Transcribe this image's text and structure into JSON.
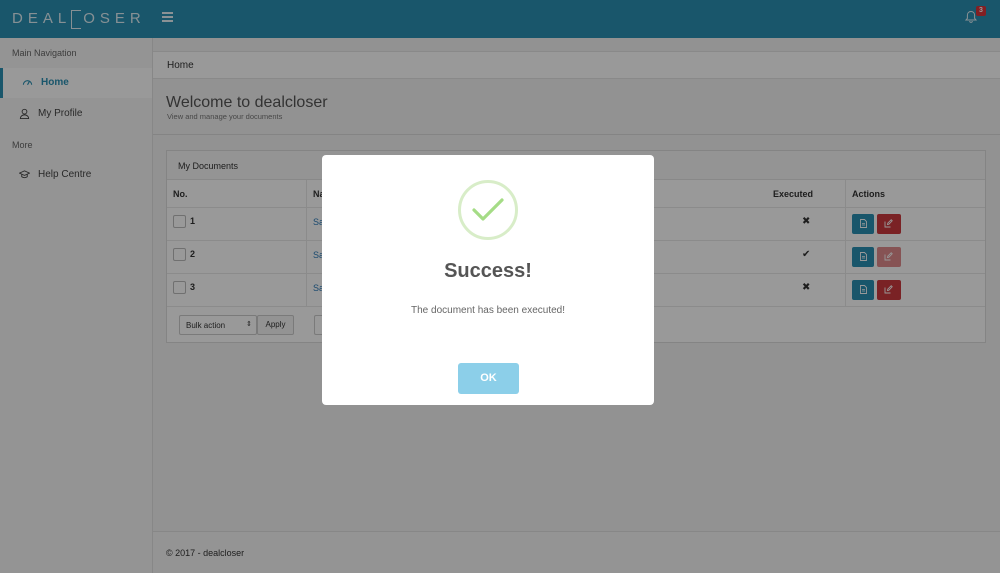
{
  "header": {
    "logo_left": "DEAL",
    "logo_right": "OSER",
    "menu_icon": "hamburger-icon",
    "bell_icon": "bell-icon",
    "notification_count": "3",
    "brand_color": "#2a8fb3"
  },
  "sidebar": {
    "main_section": "Main Navigation",
    "more_section": "More",
    "items": [
      {
        "label": "Home",
        "icon": "dashboard-icon",
        "active": true
      },
      {
        "label": "My Profile",
        "icon": "user-icon",
        "active": false
      },
      {
        "label": "Help Centre",
        "icon": "graduation-cap-icon",
        "active": false
      }
    ]
  },
  "breadcrumb": "Home",
  "page": {
    "title": "Welcome to dealcloser",
    "subtitle": "View and manage your documents"
  },
  "documents": {
    "panel_title": "My Documents",
    "columns": [
      "No.",
      "Na",
      "Executed",
      "Actions"
    ],
    "rows": [
      {
        "no": "1",
        "name": "Sa",
        "executed": "✖"
      },
      {
        "no": "2",
        "name": "Sa",
        "executed": "✔"
      },
      {
        "no": "3",
        "name": "Sa",
        "executed": "✖"
      }
    ],
    "bulk_action": "Bulk action",
    "apply_label": "Apply"
  },
  "footer": "© 2017 - dealcloser",
  "modal": {
    "icon": "success-check-icon",
    "title": "Success!",
    "message": "The document has been executed!",
    "ok_label": "OK"
  }
}
